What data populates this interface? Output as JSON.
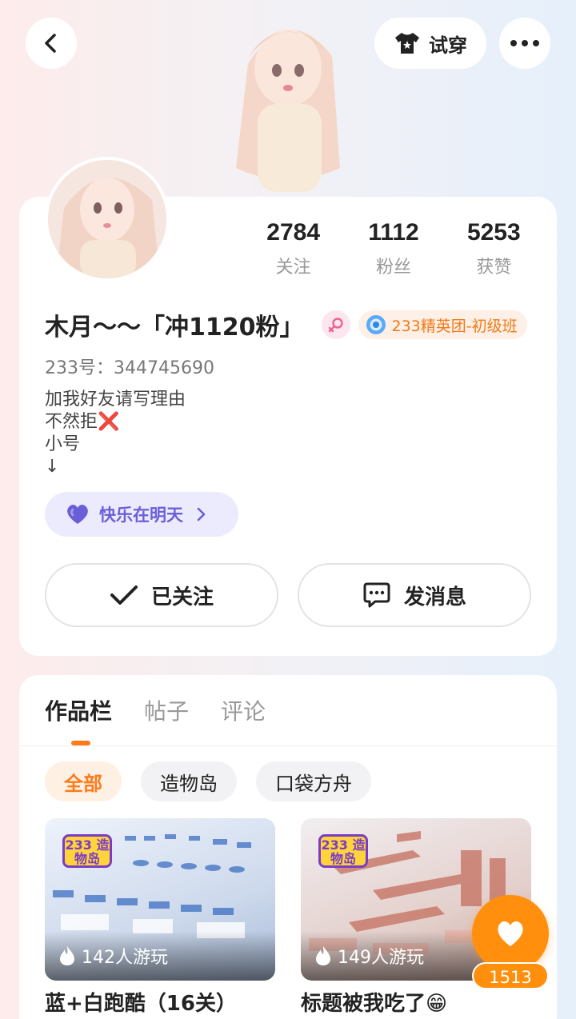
{
  "header": {
    "try_on_label": "试穿"
  },
  "profile": {
    "stats": [
      {
        "value": "2784",
        "label": "关注"
      },
      {
        "value": "1112",
        "label": "粉丝"
      },
      {
        "value": "5253",
        "label": "获赞"
      }
    ],
    "username": "木月～～「冲1120粉」",
    "gender": "female",
    "team_badge": "233精英团-初级班",
    "uid": "233号：344745690",
    "bio": "加我好友请写理由\n不然拒❌\n小号\n   ↓",
    "tag_label": "快乐在明天",
    "follow_label": "已关注",
    "message_label": "发消息"
  },
  "works": {
    "tabs": [
      "作品栏",
      "帖子",
      "评论"
    ],
    "active_tab": "作品栏",
    "filters": [
      "全部",
      "造物岛",
      "口袋方舟"
    ],
    "active_filter": "全部",
    "games": [
      {
        "logo": "233 造物岛",
        "plays": "142人游玩",
        "title": "蓝+白跑酷（16关）"
      },
      {
        "logo": "233 造物岛",
        "plays": "149人游玩",
        "title": "标题被我吃了😁"
      }
    ]
  },
  "like": {
    "count": "1513"
  },
  "colors": {
    "accent": "#ff7a1a",
    "like_fab": "#ff8f0d",
    "tag_purple": "#6a5fd6"
  }
}
